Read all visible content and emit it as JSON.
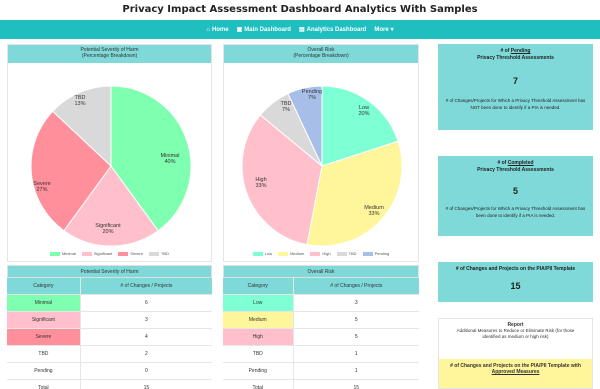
{
  "page_title": "Privacy Impact Assessment Dashboard Analytics With Samples",
  "nav": {
    "home": "Home",
    "main_dashboard": "Main Dashboard",
    "analytics_dashboard": "Analytics Dashboard",
    "more": "More"
  },
  "colors": {
    "teal_nav": "#1fbfbf",
    "panel_head": "#7fd9d9",
    "minimal": "#7fffb0",
    "significant": "#ffc0cb",
    "severe": "#ff8f9b",
    "tbd": "#d9d9d9",
    "low": "#7fffd4",
    "medium": "#fff59a",
    "high": "#ffc0cb",
    "pending": "#a7bfe8"
  },
  "chart_data": [
    {
      "type": "pie",
      "title": "Potential Severity of Harm",
      "subtitle": "(Percentage Breakdown)",
      "categories": [
        "Minimal",
        "Significant",
        "Severe",
        "TBD"
      ],
      "values": [
        40,
        20,
        27,
        13
      ]
    },
    {
      "type": "pie",
      "title": "Overall Risk",
      "subtitle": "(Percentage Breakdown)",
      "categories": [
        "Low",
        "Medium",
        "High",
        "TBD",
        "Pending"
      ],
      "values": [
        20,
        33,
        33,
        7,
        7
      ],
      "value_labels": [
        "20%",
        "33%",
        "33%",
        "7%",
        "7%"
      ]
    }
  ],
  "pie1": {
    "title": "Potential Severity of Harm",
    "subtitle": "(Percentage Breakdown)",
    "labels": {
      "minimal": "Minimal",
      "minimal_pct": "40%",
      "significant": "Significant",
      "significant_pct": "20%",
      "severe": "Severe",
      "severe_pct": "27%",
      "tbd": "TBD",
      "tbd_pct": "13%"
    }
  },
  "pie2": {
    "title": "Overall Risk",
    "subtitle": "(Percentage Breakdown)",
    "labels": {
      "low": "Low",
      "low_pct": "20%",
      "medium": "Medium",
      "medium_pct": "33%",
      "high": "High",
      "high_pct": "33%",
      "tbd": "TBD",
      "tbd_pct": "7%",
      "pending": "Pending",
      "pending_pct": "7%"
    }
  },
  "table1": {
    "title": "Potential Severity of Harm",
    "col1": "Category",
    "col2": "# of Changes / Projects",
    "rows": [
      {
        "cat": "Minimal",
        "val": "6"
      },
      {
        "cat": "Significant",
        "val": "3"
      },
      {
        "cat": "Severe",
        "val": "4"
      },
      {
        "cat": "TBD",
        "val": "2"
      },
      {
        "cat": "Pending",
        "val": "0"
      },
      {
        "cat": "Total",
        "val": "15"
      }
    ]
  },
  "table2": {
    "title": "Overall Risk",
    "col1": "Category",
    "col2": "# of Changes / Projects",
    "rows": [
      {
        "cat": "Low",
        "val": "3"
      },
      {
        "cat": "Medium",
        "val": "5"
      },
      {
        "cat": "High",
        "val": "5"
      },
      {
        "cat": "TBD",
        "val": "1"
      },
      {
        "cat": "Pending",
        "val": "1"
      },
      {
        "cat": "Total",
        "val": "15"
      }
    ]
  },
  "cards": {
    "pending": {
      "hdr1": "# of",
      "hdr_u": "Pending",
      "hdr2": "Privacy Threshold Assessments",
      "num": "7",
      "desc": "# of Changes/Projects for Which a Privacy Threshold Assessment has NOT been done to identify if a PIA is needed."
    },
    "completed": {
      "hdr1": "# of",
      "hdr_u": "Completed",
      "hdr2": "Privacy Threshold Assessments",
      "num": "5",
      "desc": "# of Changes/Projects for Which a Privacy Threshold Assessment has been done to identify if a PIA is needed."
    },
    "template": {
      "hdr": "# of Changes and Projects on the PIA/PII Template",
      "num": "15"
    },
    "report": {
      "title": "Report",
      "desc": "Additional Measures to Reduce or Eliminate Risk (for those identified as medium or high risk)",
      "hdr": "# of Changes and Projects on the PIA/PII Template with",
      "hdr_u": "Approved Measures"
    }
  }
}
